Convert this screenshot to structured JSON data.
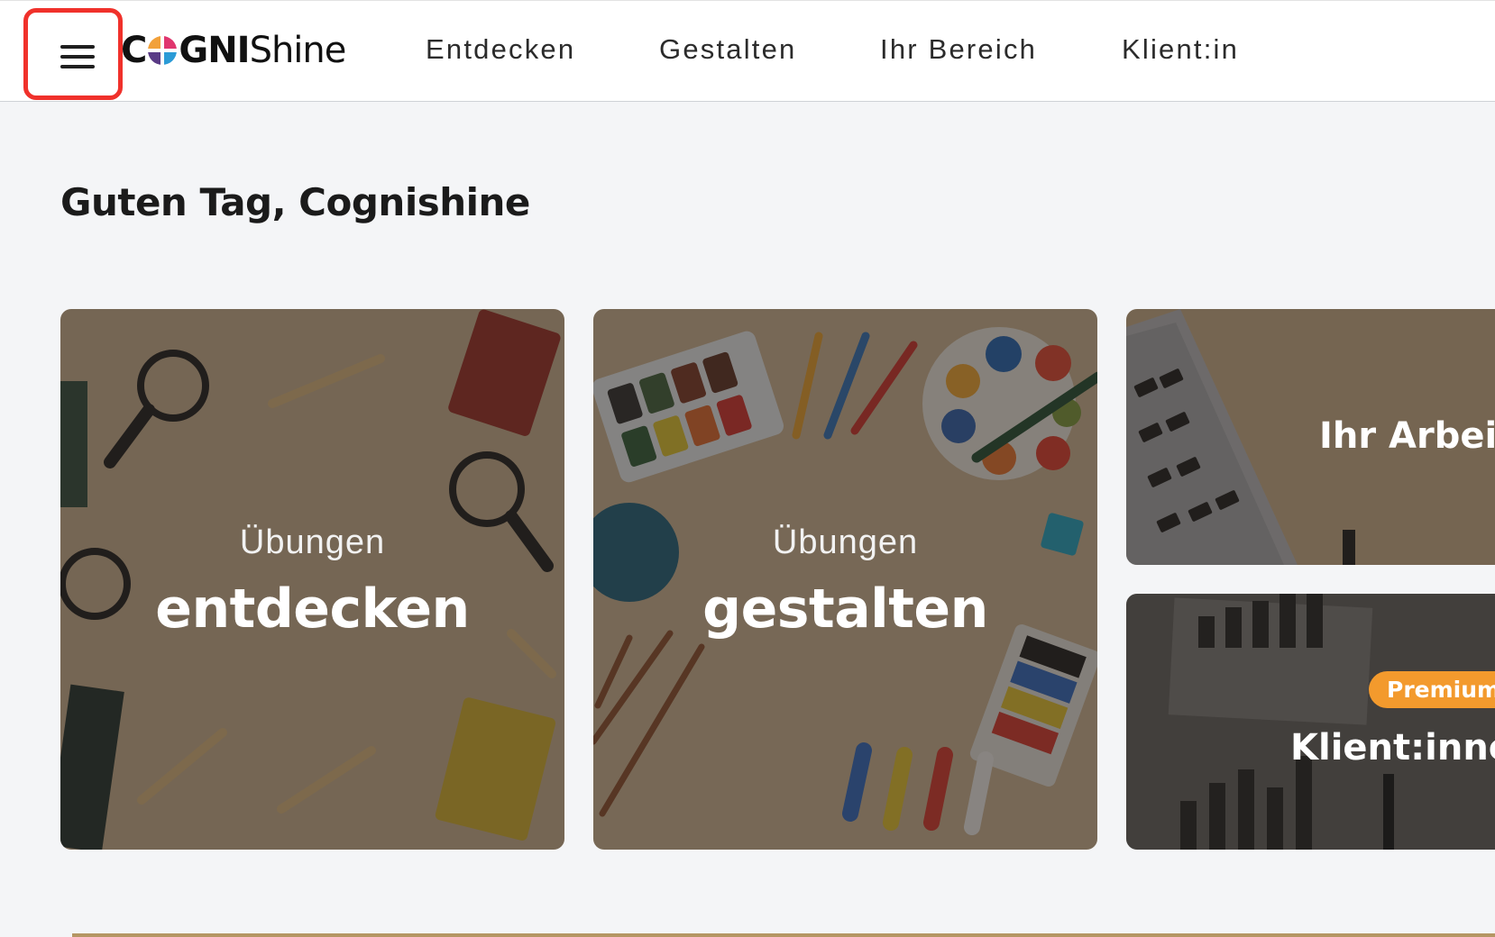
{
  "header": {
    "menu_icon": "hamburger-menu-icon",
    "logo": {
      "part1": "C",
      "part2": "GNI",
      "part3": "Shine"
    },
    "nav": [
      "Entdecken",
      "Gestalten",
      "Ihr Bereich",
      "Klient:in"
    ]
  },
  "greeting": "Guten Tag, Cognishine",
  "cards": {
    "entdecken": {
      "subtitle": "Übungen",
      "title": "entdecken"
    },
    "gestalten": {
      "subtitle": "Übungen",
      "title": "gestalten"
    },
    "arbeit": {
      "title": "Ihr Arbei"
    },
    "klienten": {
      "badge": "Premium",
      "title": "Klient:inne"
    }
  },
  "colors": {
    "highlight": "#f0312b",
    "badge": "#f39a2d",
    "background": "#f4f5f7"
  }
}
